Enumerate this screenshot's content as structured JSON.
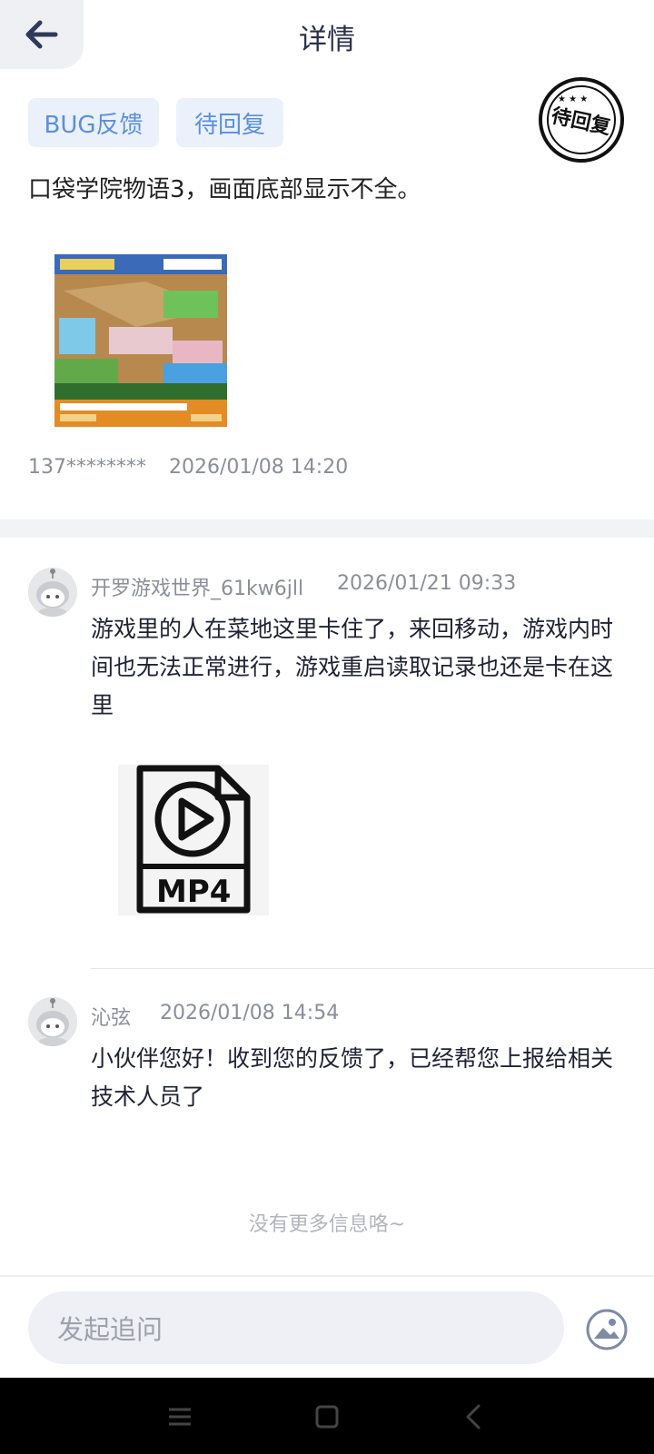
{
  "header": {
    "title": "详情"
  },
  "ticket": {
    "tag_type": "BUG反馈",
    "tag_status": "待回复",
    "stamp_text": "待回复",
    "description": "口袋学院物语3，画面底部显示不全。",
    "user": "137********",
    "time": "2026/01/08 14:20"
  },
  "comments": [
    {
      "author": "开罗游戏世界_61kw6jll",
      "time": "2026/01/21 09:33",
      "text": "游戏里的人在菜地这里卡住了，来回移动，游戏内时间也无法正常进行，游戏重启读取记录也还是卡在这里",
      "attachment_label": "MP4"
    },
    {
      "author": "沁弦",
      "time": "2026/01/08 14:54",
      "text": "小伙伴您好！收到您的反馈了，已经帮您上报给相关技术人员了"
    }
  ],
  "footer": {
    "no_more": "没有更多信息咯~",
    "input_placeholder": "发起追问"
  },
  "icons": {
    "back": "arrow-left-icon",
    "image": "image-icon",
    "video": "mp4-file-icon"
  },
  "colors": {
    "tag_bg": "#eaf1fb",
    "tag_text": "#5b8fd9",
    "title": "#2b3048"
  }
}
